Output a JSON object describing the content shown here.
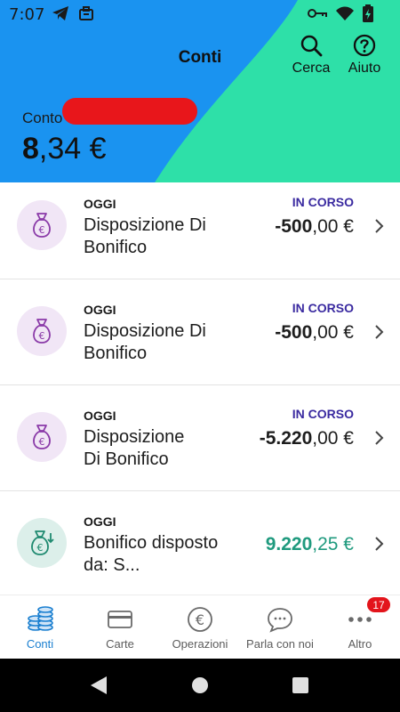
{
  "status_bar": {
    "time": "7:07",
    "left_icons": [
      "telegram-icon",
      "briefcase-icon"
    ],
    "right_icons": [
      "key-icon",
      "wifi-icon",
      "battery-icon"
    ]
  },
  "header": {
    "title": "Conti",
    "search_label": "Cerca",
    "help_label": "Aiuto",
    "account_label": "Conto",
    "balance_int": "8",
    "balance_dec": ",34 €",
    "colors": {
      "blue": "#1a93f0",
      "teal": "#2ee0a8"
    }
  },
  "transactions": [
    {
      "date": "OGGI",
      "description": "Disposizione Di Bonifico",
      "status": "IN CORSO",
      "amount_int": "-500",
      "amount_dec": ",00 €",
      "type": "outgoing"
    },
    {
      "date": "OGGI",
      "description": "Disposizione Di Bonifico",
      "status": "IN CORSO",
      "amount_int": "-500",
      "amount_dec": ",00 €",
      "type": "outgoing"
    },
    {
      "date": "OGGI",
      "description": "Disposizione Di Bonifico",
      "status": "IN CORSO",
      "amount_int": "-5.220",
      "amount_dec": ",00 €",
      "type": "outgoing"
    },
    {
      "date": "OGGI",
      "description": "Bonifico disposto da: S...",
      "status": "",
      "amount_int": "9.220",
      "amount_dec": ",25 €",
      "type": "incoming"
    }
  ],
  "bottom_nav": {
    "items": [
      {
        "label": "Conti",
        "icon": "coins-icon",
        "active": true
      },
      {
        "label": "Carte",
        "icon": "card-icon",
        "active": false
      },
      {
        "label": "Operazioni",
        "icon": "euro-icon",
        "active": false
      },
      {
        "label": "Parla con noi",
        "icon": "chat-icon",
        "active": false
      },
      {
        "label": "Altro",
        "icon": "more-icon",
        "active": false
      }
    ],
    "badge": "17"
  },
  "system_nav": [
    "back-icon",
    "home-icon",
    "recents-icon"
  ]
}
